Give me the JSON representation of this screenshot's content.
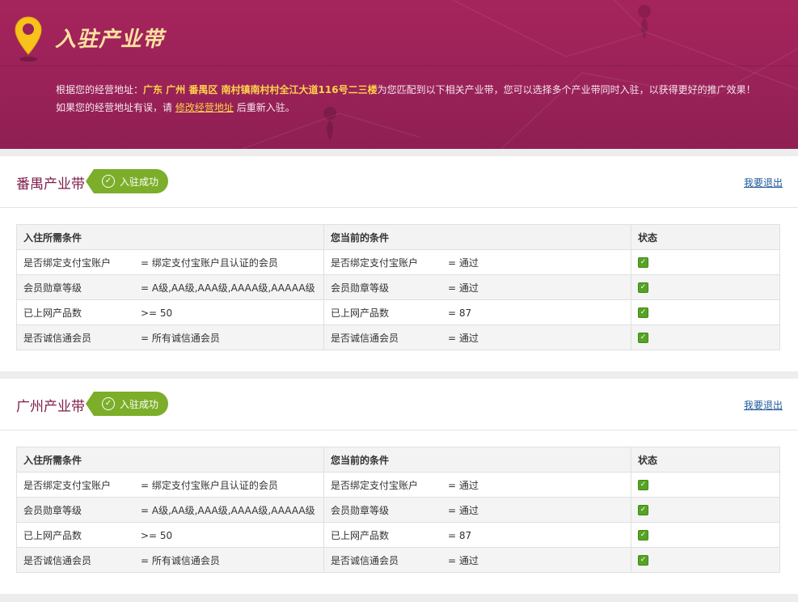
{
  "banner": {
    "title": "入驻产业带",
    "intro_prefix": "根据您的经营地址：",
    "address": "广东 广州 番禺区 南村镇南村村全江大道116号二三楼",
    "intro_suffix": "为您匹配到以下相关产业带，您可以选择多个产业带同时入驻，以获得更好的推广效果！",
    "line2_prefix": "如果您的经营地址有误，请",
    "edit_link": "修改经营地址",
    "line2_suffix": "后重新入驻。",
    "icon": "location-pin-icon",
    "colors": {
      "background": "#9a2258",
      "title": "#fbe1a0",
      "highlight": "#ffd24a"
    }
  },
  "sections": [
    {
      "zone_name": "番禺产业带",
      "badge": "入驻成功",
      "exit": "我要退出",
      "headers": [
        "入住所需条件",
        "您当前的条件",
        "状态"
      ],
      "rows": [
        {
          "req_label": "是否绑定支付宝账户",
          "req_value": "= 绑定支付宝账户且认证的会员",
          "cur_label": "是否绑定支付宝账户",
          "cur_value": "= 通过",
          "status": "passed"
        },
        {
          "req_label": "会员勋章等级",
          "req_value": "= A级,AA级,AAA级,AAAA级,AAAAA级",
          "cur_label": "会员勋章等级",
          "cur_value": "= 通过",
          "status": "passed"
        },
        {
          "req_label": "已上网产品数",
          "req_value": ">= 50",
          "cur_label": "已上网产品数",
          "cur_value": "= 87",
          "status": "passed"
        },
        {
          "req_label": "是否诚信通会员",
          "req_value": "= 所有诚信通会员",
          "cur_label": "是否诚信通会员",
          "cur_value": "= 通过",
          "status": "passed"
        }
      ]
    },
    {
      "zone_name": "广州产业带",
      "badge": "入驻成功",
      "exit": "我要退出",
      "headers": [
        "入住所需条件",
        "您当前的条件",
        "状态"
      ],
      "rows": [
        {
          "req_label": "是否绑定支付宝账户",
          "req_value": "= 绑定支付宝账户且认证的会员",
          "cur_label": "是否绑定支付宝账户",
          "cur_value": "= 通过",
          "status": "passed"
        },
        {
          "req_label": "会员勋章等级",
          "req_value": "= A级,AA级,AAA级,AAAA级,AAAAA级",
          "cur_label": "会员勋章等级",
          "cur_value": "= 通过",
          "status": "passed"
        },
        {
          "req_label": "已上网产品数",
          "req_value": ">= 50",
          "cur_label": "已上网产品数",
          "cur_value": "= 87",
          "status": "passed"
        },
        {
          "req_label": "是否诚信通会员",
          "req_value": "= 所有诚信通会员",
          "cur_label": "是否诚信通会员",
          "cur_value": "= 通过",
          "status": "passed"
        }
      ]
    }
  ],
  "theme": {
    "zone_title": "#7f1d4a",
    "badge_green": "#7cae2a",
    "check_green": "#57a325",
    "link_blue": "#1f5a99"
  }
}
